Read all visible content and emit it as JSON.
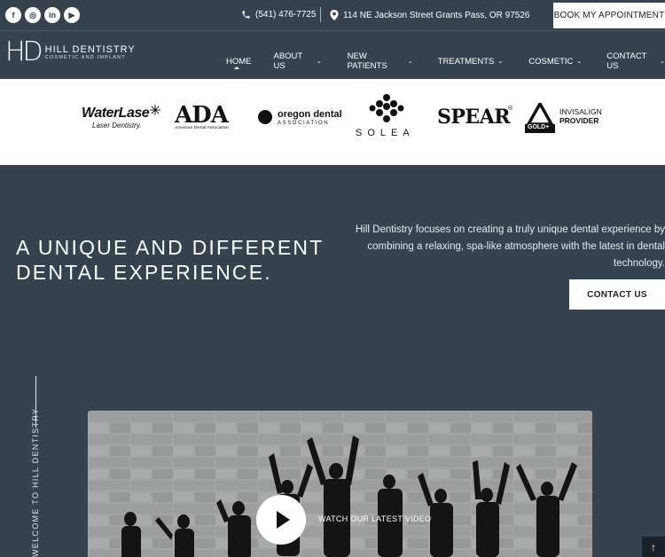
{
  "topbar": {
    "social": [
      {
        "icon": "facebook-icon",
        "glyph": "f"
      },
      {
        "icon": "instagram-icon",
        "glyph": "◎"
      },
      {
        "icon": "linkedin-icon",
        "glyph": "in"
      },
      {
        "icon": "youtube-icon",
        "glyph": "▶"
      }
    ],
    "phone": "(541) 476-7725",
    "address": "114 NE Jackson Street Grants Pass, OR 97526",
    "book_label": "BOOK MY APPOINTMENT"
  },
  "logo": {
    "mark": "HD",
    "name": "HILL DENTISTRY",
    "tagline": "COSMETIC AND IMPLANT"
  },
  "nav": {
    "items": [
      {
        "label": "HOME",
        "dropdown": false
      },
      {
        "label": "ABOUT US",
        "dropdown": true
      },
      {
        "label": "NEW PATIENTS",
        "dropdown": true
      },
      {
        "label": "TREATMENTS",
        "dropdown": true
      },
      {
        "label": "COSMETIC",
        "dropdown": true
      },
      {
        "label": "CONTACT US",
        "dropdown": true
      }
    ]
  },
  "affiliations": {
    "waterlase": "WaterLase",
    "waterlase_sub": "Laser Dentistry.",
    "ada": "ADA",
    "ada_sub": "American Dental Association",
    "oda": "oregon dental",
    "oda_sub": "ASSOCIATION",
    "solea": "SOLEA",
    "spear": "SPEAR",
    "spear_mark": "®",
    "invisalign": "INVISALIGN",
    "invisalign_sub": "PROVIDER",
    "invisalign_badge": "GOLD+"
  },
  "hero": {
    "heading_line1": "A UNIQUE AND DIFFERENT",
    "heading_line2": "DENTAL EXPERIENCE.",
    "intro": "Hill Dentistry focuses on creating a truly unique dental experience by combining a relaxing, spa-like atmosphere with the latest in dental technology.",
    "contact_label": "CONTACT US",
    "welcome": "WELCOME TO HILL DENTISTRY"
  },
  "video": {
    "watch_label": "WATCH OUR LATEST VIDEO"
  },
  "colors": {
    "background": "#36424d",
    "button_bg": "#ffffff",
    "scroll_top_bg": "#1b2128"
  }
}
